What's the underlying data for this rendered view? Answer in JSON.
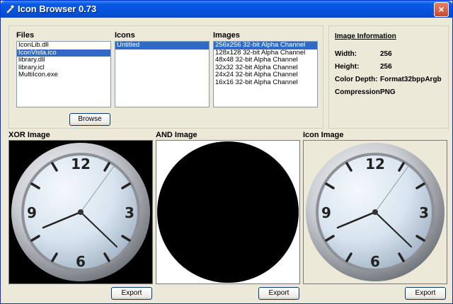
{
  "window": {
    "title": "Icon Browser 0.73",
    "close_glyph": "×"
  },
  "files": {
    "label": "Files",
    "items": [
      "IconLib.dll",
      "IconVista.ico",
      "library.dll",
      "library.icl",
      "MultiIcon.exe"
    ],
    "selected_index": 1
  },
  "icons": {
    "label": "Icons",
    "items": [
      "Untitled"
    ],
    "selected_index": 0
  },
  "images": {
    "label": "Images",
    "items": [
      "256x256 32-bit Alpha Channel",
      "128x128 32-bit Alpha Channel",
      "48x48 32-bit Alpha Channel",
      "32x32 32-bit Alpha Channel",
      "24x24 32-bit Alpha Channel",
      "16x16 32-bit Alpha Channel"
    ],
    "selected_index": 0
  },
  "browse_button": "Browse",
  "image_info": {
    "title": "Image Information",
    "width_label": "Width:",
    "width_value": "256",
    "height_label": "Height:",
    "height_value": "256",
    "depth_label": "Color Depth:",
    "depth_value": "Format32bppArgb",
    "compression_label": "Compression:",
    "compression_value": "PNG"
  },
  "panes": {
    "xor_label": "XOR Image",
    "and_label": "AND Image",
    "icon_label": "Icon Image"
  },
  "clock": {
    "n12": "12",
    "n3": "3",
    "n6": "6",
    "n9": "9"
  },
  "export_button": "Export",
  "colors": {
    "selection": "#316ac5",
    "titlebar": "#0a5ae6",
    "face": "#ece9d8"
  }
}
